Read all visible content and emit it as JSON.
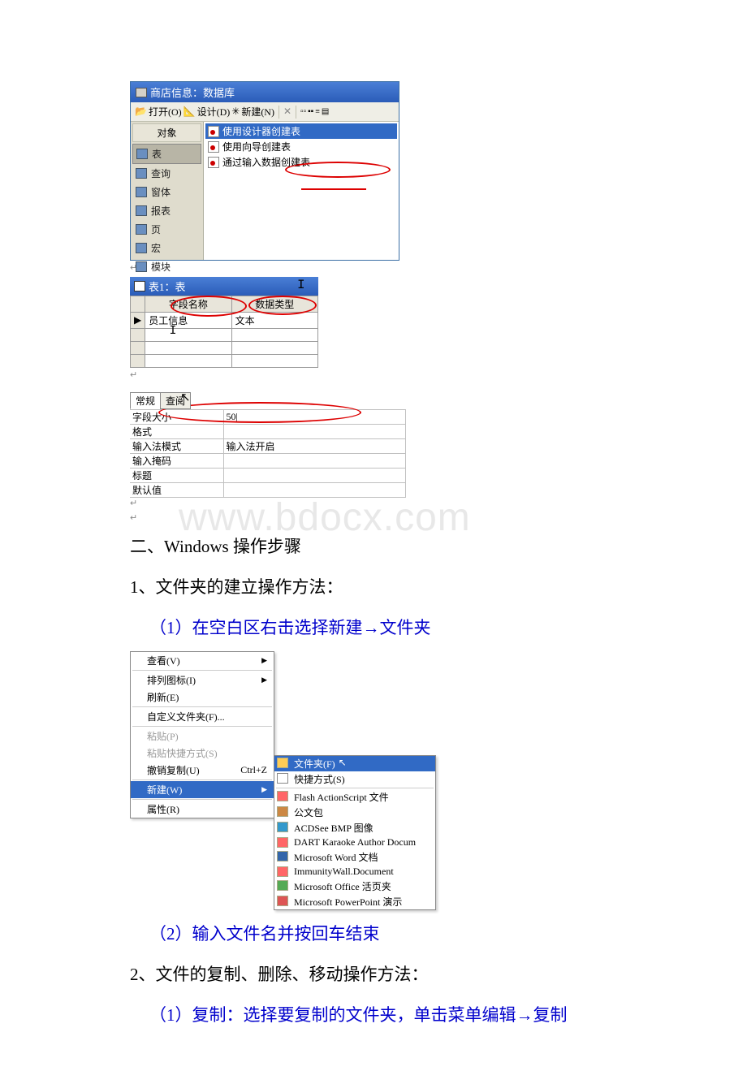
{
  "watermark": "www.bdocx.com",
  "db_window": {
    "title": "商店信息：数据库",
    "toolbar": {
      "open": "打开(O)",
      "design": "设计(D)",
      "new": "新建(N)"
    },
    "sidebar_header": "对象",
    "sidebar": [
      "表",
      "查询",
      "窗体",
      "报表",
      "页",
      "宏",
      "模块"
    ],
    "main_items": [
      "使用设计器创建表",
      "使用向导创建表",
      "通过输入数据创建表"
    ]
  },
  "table_window": {
    "title": "表1：表",
    "col1": "字段名称",
    "col2": "数据类型",
    "row1_field": "员工信息",
    "row1_type": "文本"
  },
  "props": {
    "tab1": "常规",
    "tab2": "查阅",
    "rows": [
      {
        "k": "字段大小",
        "v": "50"
      },
      {
        "k": "格式",
        "v": ""
      },
      {
        "k": "输入法模式",
        "v": "输入法开启"
      },
      {
        "k": "输入掩码",
        "v": ""
      },
      {
        "k": "标题",
        "v": ""
      },
      {
        "k": "默认值",
        "v": ""
      }
    ]
  },
  "text": {
    "heading2": "二、Windows 操作步骤",
    "step1": "1、文件夹的建立操作方法：",
    "step1_1": "（1）在空白区右击选择新建→文件夹",
    "step1_2": "（2）输入文件名并按回车结束",
    "step2": "2、文件的复制、删除、移动操作方法：",
    "step2_1": "（1）复制：选择要复制的文件夹，单击菜单编辑→复制"
  },
  "ctx_menu": {
    "items": [
      {
        "label": "查看(V)",
        "sub": true
      },
      {
        "sep": true
      },
      {
        "label": "排列图标(I)",
        "sub": true
      },
      {
        "label": "刷新(E)"
      },
      {
        "sep": true
      },
      {
        "label": "自定义文件夹(F)..."
      },
      {
        "sep": true
      },
      {
        "label": "粘贴(P)",
        "disabled": true
      },
      {
        "label": "粘贴快捷方式(S)",
        "disabled": true
      },
      {
        "label": "撤销复制(U)",
        "shortcut": "Ctrl+Z"
      },
      {
        "sep": true
      },
      {
        "label": "新建(W)",
        "sub": true,
        "highlight": true
      },
      {
        "sep": true
      },
      {
        "label": "属性(R)"
      }
    ]
  },
  "submenu": {
    "items": [
      {
        "label": "文件夹(F)",
        "highlight": true,
        "icon": "fd"
      },
      {
        "label": "快捷方式(S)",
        "icon": "sc"
      },
      {
        "sep": true
      },
      {
        "label": "Flash ActionScript 文件",
        "icon": "fl"
      },
      {
        "label": "公文包",
        "icon": "br"
      },
      {
        "label": "ACDSee BMP 图像",
        "icon": "bm"
      },
      {
        "label": "DART Karaoke Author Docum",
        "icon": "fl"
      },
      {
        "label": "Microsoft Word 文档",
        "icon": "wd"
      },
      {
        "label": "ImmunityWall.Document",
        "icon": "fl"
      },
      {
        "label": "Microsoft Office 活页夹",
        "icon": "oh"
      },
      {
        "label": "Microsoft PowerPoint 演示",
        "icon": "pp"
      }
    ]
  }
}
